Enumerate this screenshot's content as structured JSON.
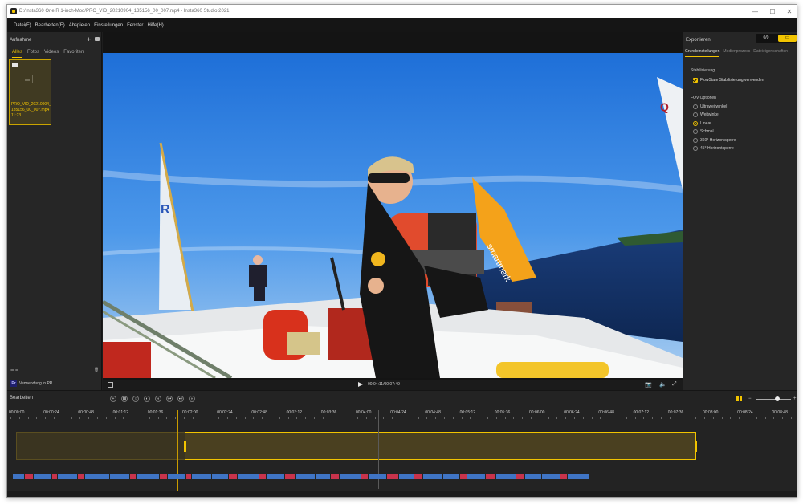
{
  "window": {
    "title": "D:/Insta360 One R 1-inch-Mod/PRO_VID_20210904_135156_00_007.mp4 - Insta360 Studio 2021",
    "controls": [
      "—",
      "☐",
      "✕"
    ]
  },
  "menu": [
    "Datei(F)",
    "Bearbeiten(E)",
    "Abspielen",
    "Einstellungen",
    "Fenster",
    "Hilfe(H)"
  ],
  "left_panel": {
    "title": "Aufnahme",
    "tabs": [
      "Alles",
      "Fotos",
      "Videos",
      "Favoriten"
    ],
    "active_tab": "Alles",
    "thumbnail": {
      "filename": "PRO_VID_20210904_135156_00_007.mp4",
      "duration": "11:23"
    },
    "pr_label": "Verwendung in PR",
    "pr_badge": "Pr"
  },
  "player": {
    "time": "00:04:11/00:07:49"
  },
  "right_panel": {
    "export_label": "Exportieren",
    "toggle_left": "0/0",
    "tabs": [
      "Grundeinstellungen",
      "Medienprozess",
      "Dateieigenschaften"
    ],
    "active_tab": "Grundeinstellungen",
    "stabilization_title": "Stabilisierung",
    "flowstate_label": "FlowState Stabilisierung verwenden",
    "flowstate_checked": true,
    "fov_title": "FOV Optionen",
    "fov_options": [
      "Ultraweitwinkel",
      "Weitwinkel",
      "Linear",
      "Schmal",
      "360° Horizontsperre",
      "45° Horizontsperre"
    ],
    "fov_selected": "Linear"
  },
  "timeline": {
    "title": "Bearbeiten",
    "ruler_labels": [
      "00:00:00",
      "00:00:24",
      "00:00:48",
      "00:01:12",
      "00:01:36",
      "00:02:00",
      "00:02:24",
      "00:02:48",
      "00:03:12",
      "00:03:36",
      "00:04:00",
      "00:04:24",
      "00:04:48",
      "00:05:12",
      "00:05:36",
      "00:06:00",
      "00:06:24",
      "00:06:48",
      "00:07:12",
      "00:07:36",
      "00:08:00",
      "00:08:24",
      "00:08:48"
    ]
  },
  "colors": {
    "accent": "#f2c400",
    "panel": "#262626",
    "speed_blue": "#3f74c4",
    "speed_red": "#c8334b"
  }
}
